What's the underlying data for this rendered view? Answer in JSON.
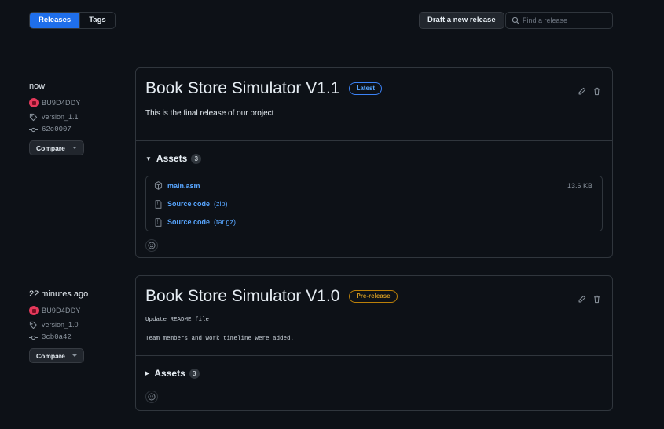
{
  "toolbar": {
    "releases_tab": "Releases",
    "tags_tab": "Tags",
    "draft_button": "Draft a new release",
    "search_placeholder": "Find a release"
  },
  "releases": [
    {
      "time": "now",
      "author": "BU9D4DDY",
      "tag": "version_1.1",
      "commit": "62c0007",
      "compare_label": "Compare",
      "title": "Book Store Simulator V1.1",
      "badge": "Latest",
      "notes": "This is the final release of our project",
      "assets_label": "Assets",
      "assets_count": "3",
      "assets": [
        {
          "name": "main.asm",
          "format": "",
          "size": "13.6 KB",
          "icon": "package-icon"
        },
        {
          "name": "Source code",
          "format": "(zip)",
          "size": "",
          "icon": "file-zip-icon"
        },
        {
          "name": "Source code",
          "format": "(tar.gz)",
          "size": "",
          "icon": "file-zip-icon"
        }
      ]
    },
    {
      "time": "22 minutes ago",
      "author": "BU9D4DDY",
      "tag": "version_1.0",
      "commit": "3cb0a42",
      "compare_label": "Compare",
      "title": "Book Store Simulator V1.0",
      "badge": "Pre-release",
      "notes_lines": [
        "Update README file",
        "Team members and work timeline were added."
      ],
      "assets_label": "Assets",
      "assets_count": "3"
    }
  ],
  "colors": {
    "background": "#0d1117",
    "accent": "#1f6feb",
    "link": "#58a6ff",
    "latest_badge": "#3b82f6",
    "prerelease_badge": "#d29922",
    "avatar": "#e5395b"
  }
}
